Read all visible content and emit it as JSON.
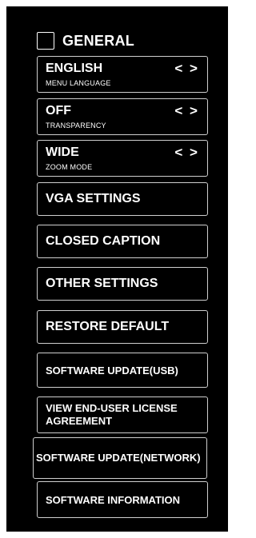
{
  "header": {
    "label": "GENERAL"
  },
  "value_items": [
    {
      "value": "ENGLISH",
      "label": "MENU LANGUAGE",
      "arrows": "< >"
    },
    {
      "value": "OFF",
      "label": "TRANSPARENCY",
      "arrows": "< >"
    },
    {
      "value": "WIDE",
      "label": "ZOOM MODE",
      "arrows": "< >"
    }
  ],
  "buttons": [
    "VGA SETTINGS",
    "CLOSED CAPTION",
    "OTHER SETTINGS",
    "RESTORE DEFAULT",
    "SOFTWARE UPDATE(USB)",
    "VIEW END-USER LICENSE AGREEMENT",
    "SOFTWARE UPDATE(NETWORK)",
    "SOFTWARE INFORMATION"
  ]
}
